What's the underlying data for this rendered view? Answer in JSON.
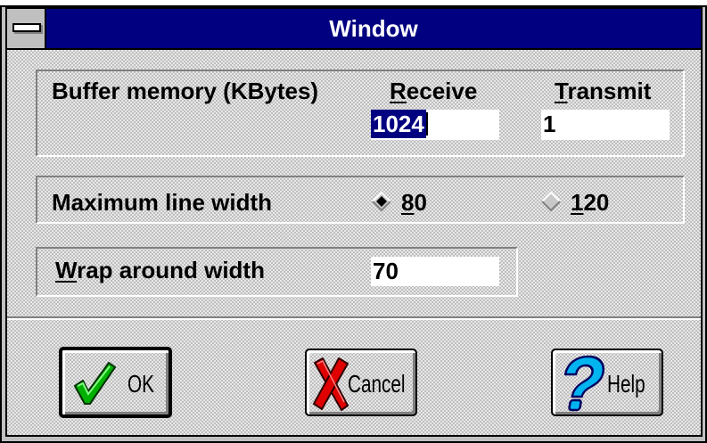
{
  "window": {
    "title": "Window",
    "colors": {
      "title_bar": "#000080",
      "title_text": "#ffffff",
      "face": "#c0c0c0",
      "selection": "#000080",
      "field": "#ffffff"
    }
  },
  "system_menu": {
    "icon": "system-menu-bar-icon"
  },
  "buffer_memory": {
    "label": "Buffer memory (KBytes)",
    "receive": {
      "label": "Receive",
      "accel": "R",
      "value": "1024",
      "text_selected": true
    },
    "transmit": {
      "label": "Transmit",
      "accel": "T",
      "value": "1",
      "text_selected": false
    }
  },
  "max_line_width": {
    "label": "Maximum line width",
    "options": [
      {
        "label": "80",
        "accel": "8",
        "selected": true
      },
      {
        "label": "120",
        "accel": "1",
        "selected": false
      }
    ]
  },
  "wrap_around": {
    "label": "Wrap around width",
    "accel": "W",
    "value": "70"
  },
  "buttons": {
    "ok": {
      "label": "OK",
      "icon": "checkmark-icon",
      "default": true
    },
    "cancel": {
      "label": "Cancel",
      "icon": "red-x-icon"
    },
    "help": {
      "label": "Help",
      "icon": "question-mark-icon"
    }
  }
}
